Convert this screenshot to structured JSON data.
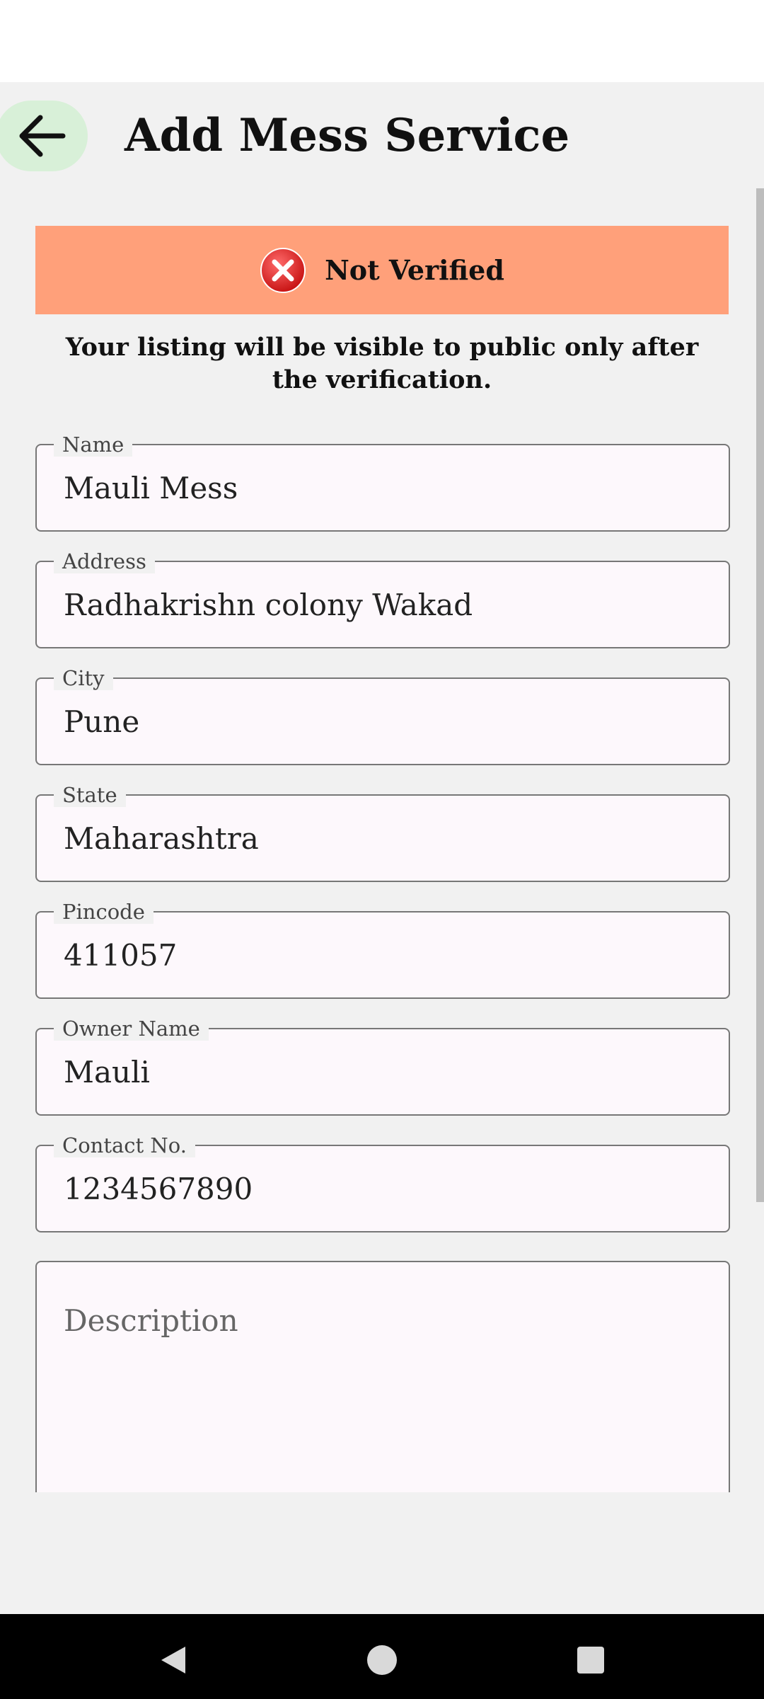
{
  "header": {
    "title": "Add Mess Service",
    "back_icon": "arrow-left-icon"
  },
  "banner": {
    "status_text": "Not Verified",
    "status_icon": "error-x-icon",
    "background_color": "#ffa07a"
  },
  "notice": {
    "text": "Your listing will be visible to public only after the verification."
  },
  "form": {
    "name": {
      "label": "Name",
      "value": "Mauli Mess"
    },
    "address": {
      "label": "Address",
      "value": "Radhakrishn colony Wakad"
    },
    "city": {
      "label": "City",
      "value": "Pune"
    },
    "state": {
      "label": "State",
      "value": "Maharashtra"
    },
    "pincode": {
      "label": "Pincode",
      "value": "411057"
    },
    "owner_name": {
      "label": "Owner Name",
      "value": "Mauli"
    },
    "contact": {
      "label": "Contact No.",
      "value": "1234567890"
    },
    "description": {
      "placeholder": "Description",
      "value": ""
    }
  },
  "nav": {
    "back_icon": "nav-back-triangle-icon",
    "home_icon": "nav-home-circle-icon",
    "recents_icon": "nav-recents-square-icon"
  }
}
